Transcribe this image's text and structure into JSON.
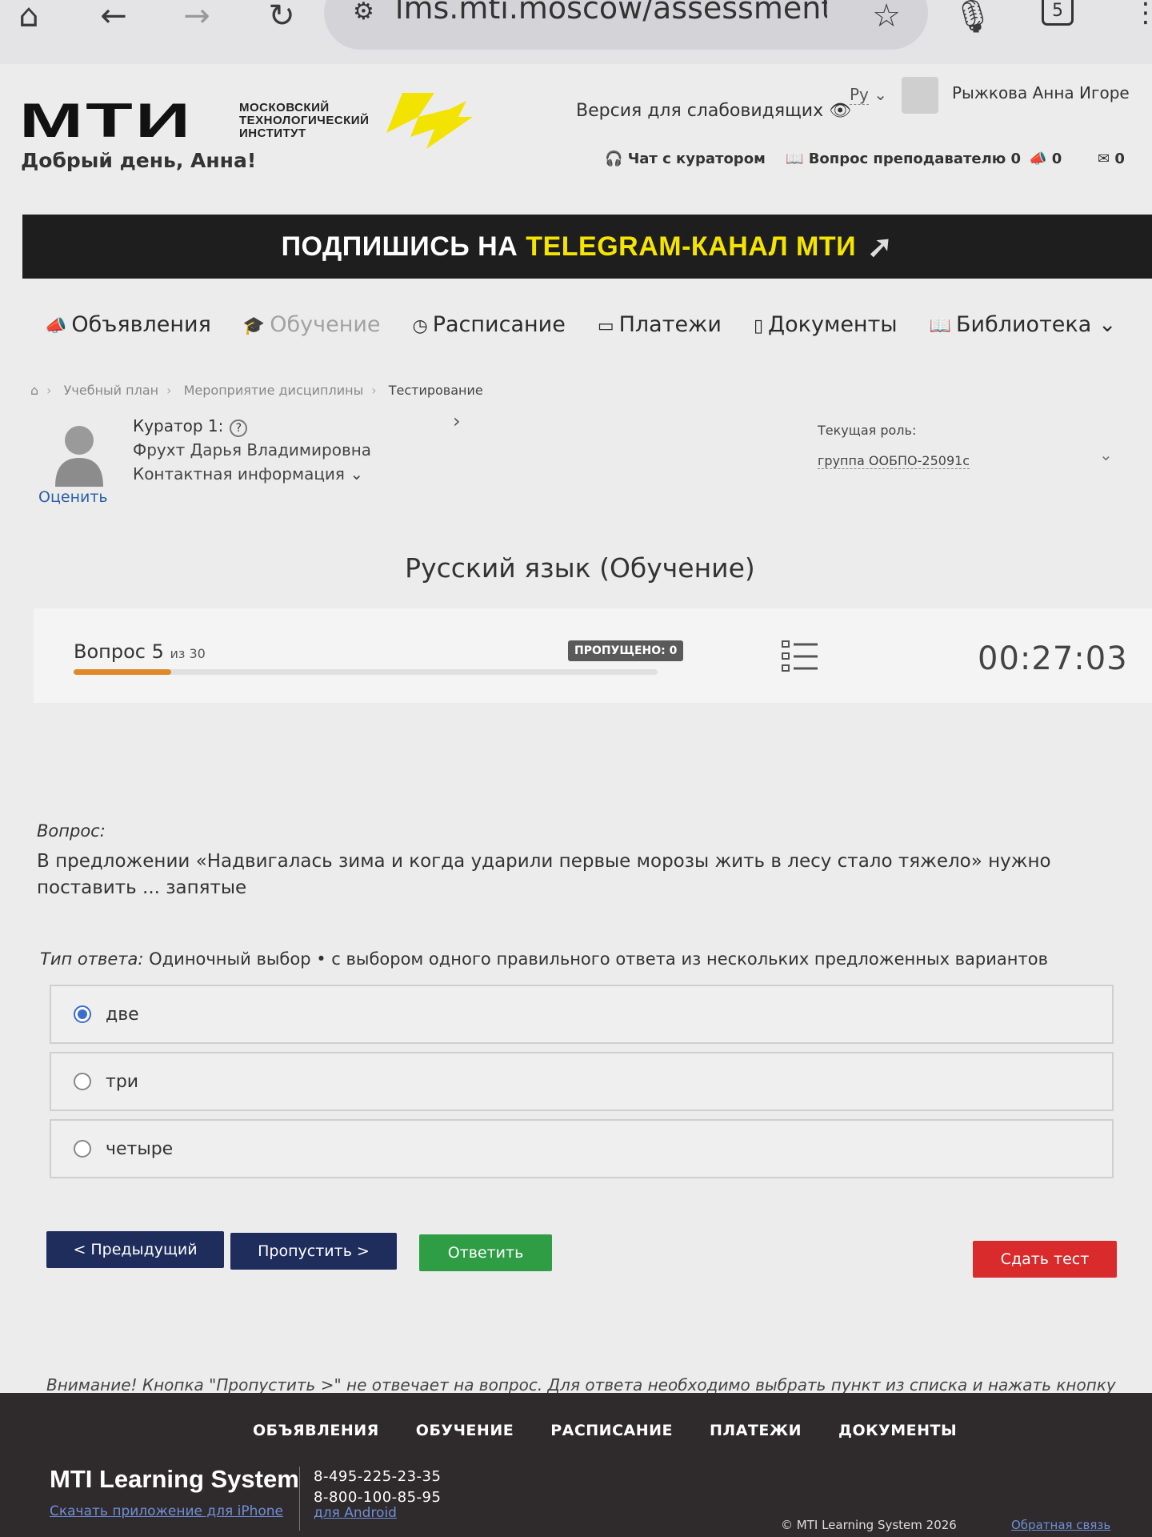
{
  "browser": {
    "url": "lms.mti.moscow/assessment:",
    "tab_count": "5"
  },
  "header": {
    "logo_text": "МТИ",
    "logo_sub": [
      "МОСКОВСКИЙ",
      "ТЕХНОЛОГИЧЕСКИЙ",
      "ИНСТИТУТ"
    ],
    "vision_link": "Версия для слабовидящих",
    "lang": "Ру",
    "user_name": "Рыжкова Анна Игоре",
    "greeting": "Добрый день, Анна!",
    "chat_curator": "Чат с куратором",
    "teacher_question": "Вопрос преподавателю 0",
    "announce_count": "0",
    "mail_count": "0"
  },
  "banner": {
    "part1": "ПОДПИШИСЬ НА",
    "part2": "TELEGRAM-КАНАЛ МТИ"
  },
  "nav": [
    {
      "label": "Объявления",
      "icon": "megaphone-icon"
    },
    {
      "label": "Обучение",
      "icon": "graduation-cap-icon"
    },
    {
      "label": "Расписание",
      "icon": "clock-icon"
    },
    {
      "label": "Платежи",
      "icon": "money-icon"
    },
    {
      "label": "Документы",
      "icon": "document-icon"
    },
    {
      "label": "Библиотека",
      "icon": "book-icon"
    }
  ],
  "breadcrumbs": [
    "Учебный план",
    "Мероприятие дисциплины",
    "Тестирование"
  ],
  "curator": {
    "title": "Куратор 1:",
    "name": "Фрухт Дарья Владимировна",
    "contact": "Контактная информация",
    "rate": "Оценить"
  },
  "role": {
    "label": "Текущая роль:",
    "value": "группа ООБПО-25091с"
  },
  "page_title": "Русский язык (Обучение)",
  "question_bar": {
    "question_label": "Вопрос 5",
    "of_total": "из 30",
    "progress": 0.1667,
    "skipped": "ПРОПУЩЕНО: 0",
    "timer": "00:27:03"
  },
  "question": {
    "label": "Вопрос:",
    "text": "В предложении «Надвигалась зима и когда ударили первые морозы жить в лесу стало тяжело» нужно поставить ... запятые",
    "answer_type_label": "Тип ответа:",
    "answer_type": "Одиночный выбор • с выбором одного правильного ответа из нескольких предложенных вариантов"
  },
  "options": [
    {
      "label": "две",
      "selected": true
    },
    {
      "label": "три",
      "selected": false
    },
    {
      "label": "четыре",
      "selected": false
    }
  ],
  "buttons": {
    "prev": "< Предыдущий",
    "skip": "Пропустить >",
    "answer": "Ответить",
    "submit": "Сдать тест"
  },
  "warning": "Внимание! Кнопка \"Пропустить >\" не отвечает на вопрос. Для ответа необходимо выбрать пункт из списка и нажать кнопку \"Ответить\".",
  "footer": {
    "nav": [
      "ОБЪЯВЛЕНИЯ",
      "ОБУЧЕНИЕ",
      "РАСПИСАНИЕ",
      "ПЛАТЕЖИ",
      "ДОКУМЕНТЫ"
    ],
    "brand": "MTI Learning System",
    "iphone": "Скачать приложение для iPhone",
    "phone1": "8-495-225-23-35",
    "phone2": "8-800-100-85-95",
    "android": "для Android",
    "copyright": "© MTI Learning System 2026",
    "feedback": "Обратная связь"
  },
  "colors": {
    "accent_orange": "#e0892a",
    "navy": "#1f2d5c",
    "green": "#2e9d44",
    "red": "#d92b2b",
    "banner_yellow": "#f5e400"
  }
}
